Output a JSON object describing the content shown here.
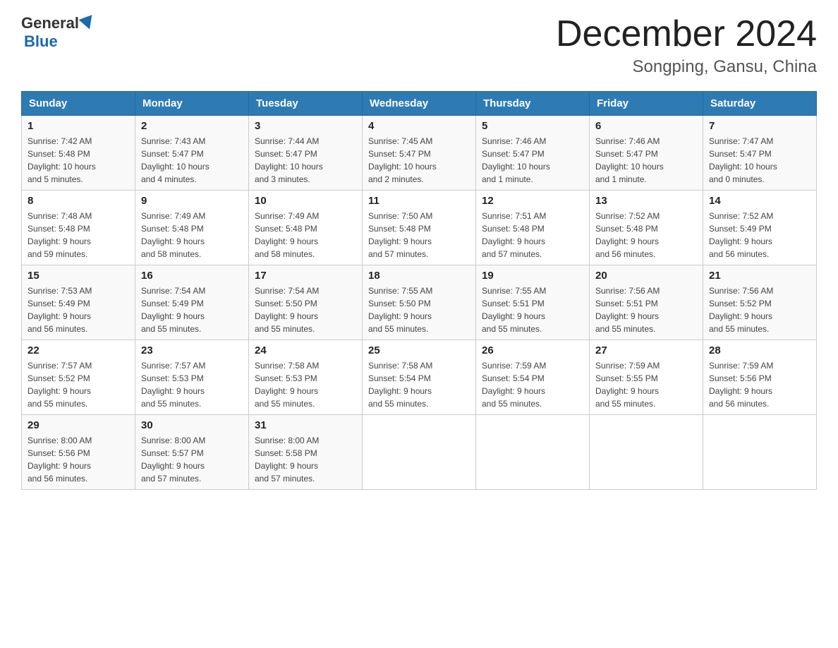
{
  "header": {
    "logo": {
      "general": "General",
      "blue": "Blue"
    },
    "title": "December 2024",
    "location": "Songping, Gansu, China"
  },
  "days_of_week": [
    "Sunday",
    "Monday",
    "Tuesday",
    "Wednesday",
    "Thursday",
    "Friday",
    "Saturday"
  ],
  "weeks": [
    [
      {
        "day": "1",
        "sunrise": "7:42 AM",
        "sunset": "5:48 PM",
        "daylight": "10 hours and 5 minutes."
      },
      {
        "day": "2",
        "sunrise": "7:43 AM",
        "sunset": "5:47 PM",
        "daylight": "10 hours and 4 minutes."
      },
      {
        "day": "3",
        "sunrise": "7:44 AM",
        "sunset": "5:47 PM",
        "daylight": "10 hours and 3 minutes."
      },
      {
        "day": "4",
        "sunrise": "7:45 AM",
        "sunset": "5:47 PM",
        "daylight": "10 hours and 2 minutes."
      },
      {
        "day": "5",
        "sunrise": "7:46 AM",
        "sunset": "5:47 PM",
        "daylight": "10 hours and 1 minute."
      },
      {
        "day": "6",
        "sunrise": "7:46 AM",
        "sunset": "5:47 PM",
        "daylight": "10 hours and 1 minute."
      },
      {
        "day": "7",
        "sunrise": "7:47 AM",
        "sunset": "5:47 PM",
        "daylight": "10 hours and 0 minutes."
      }
    ],
    [
      {
        "day": "8",
        "sunrise": "7:48 AM",
        "sunset": "5:48 PM",
        "daylight": "9 hours and 59 minutes."
      },
      {
        "day": "9",
        "sunrise": "7:49 AM",
        "sunset": "5:48 PM",
        "daylight": "9 hours and 58 minutes."
      },
      {
        "day": "10",
        "sunrise": "7:49 AM",
        "sunset": "5:48 PM",
        "daylight": "9 hours and 58 minutes."
      },
      {
        "day": "11",
        "sunrise": "7:50 AM",
        "sunset": "5:48 PM",
        "daylight": "9 hours and 57 minutes."
      },
      {
        "day": "12",
        "sunrise": "7:51 AM",
        "sunset": "5:48 PM",
        "daylight": "9 hours and 57 minutes."
      },
      {
        "day": "13",
        "sunrise": "7:52 AM",
        "sunset": "5:48 PM",
        "daylight": "9 hours and 56 minutes."
      },
      {
        "day": "14",
        "sunrise": "7:52 AM",
        "sunset": "5:49 PM",
        "daylight": "9 hours and 56 minutes."
      }
    ],
    [
      {
        "day": "15",
        "sunrise": "7:53 AM",
        "sunset": "5:49 PM",
        "daylight": "9 hours and 56 minutes."
      },
      {
        "day": "16",
        "sunrise": "7:54 AM",
        "sunset": "5:49 PM",
        "daylight": "9 hours and 55 minutes."
      },
      {
        "day": "17",
        "sunrise": "7:54 AM",
        "sunset": "5:50 PM",
        "daylight": "9 hours and 55 minutes."
      },
      {
        "day": "18",
        "sunrise": "7:55 AM",
        "sunset": "5:50 PM",
        "daylight": "9 hours and 55 minutes."
      },
      {
        "day": "19",
        "sunrise": "7:55 AM",
        "sunset": "5:51 PM",
        "daylight": "9 hours and 55 minutes."
      },
      {
        "day": "20",
        "sunrise": "7:56 AM",
        "sunset": "5:51 PM",
        "daylight": "9 hours and 55 minutes."
      },
      {
        "day": "21",
        "sunrise": "7:56 AM",
        "sunset": "5:52 PM",
        "daylight": "9 hours and 55 minutes."
      }
    ],
    [
      {
        "day": "22",
        "sunrise": "7:57 AM",
        "sunset": "5:52 PM",
        "daylight": "9 hours and 55 minutes."
      },
      {
        "day": "23",
        "sunrise": "7:57 AM",
        "sunset": "5:53 PM",
        "daylight": "9 hours and 55 minutes."
      },
      {
        "day": "24",
        "sunrise": "7:58 AM",
        "sunset": "5:53 PM",
        "daylight": "9 hours and 55 minutes."
      },
      {
        "day": "25",
        "sunrise": "7:58 AM",
        "sunset": "5:54 PM",
        "daylight": "9 hours and 55 minutes."
      },
      {
        "day": "26",
        "sunrise": "7:59 AM",
        "sunset": "5:54 PM",
        "daylight": "9 hours and 55 minutes."
      },
      {
        "day": "27",
        "sunrise": "7:59 AM",
        "sunset": "5:55 PM",
        "daylight": "9 hours and 55 minutes."
      },
      {
        "day": "28",
        "sunrise": "7:59 AM",
        "sunset": "5:56 PM",
        "daylight": "9 hours and 56 minutes."
      }
    ],
    [
      {
        "day": "29",
        "sunrise": "8:00 AM",
        "sunset": "5:56 PM",
        "daylight": "9 hours and 56 minutes."
      },
      {
        "day": "30",
        "sunrise": "8:00 AM",
        "sunset": "5:57 PM",
        "daylight": "9 hours and 57 minutes."
      },
      {
        "day": "31",
        "sunrise": "8:00 AM",
        "sunset": "5:58 PM",
        "daylight": "9 hours and 57 minutes."
      },
      null,
      null,
      null,
      null
    ]
  ],
  "labels": {
    "sunrise": "Sunrise:",
    "sunset": "Sunset:",
    "daylight": "Daylight:"
  }
}
